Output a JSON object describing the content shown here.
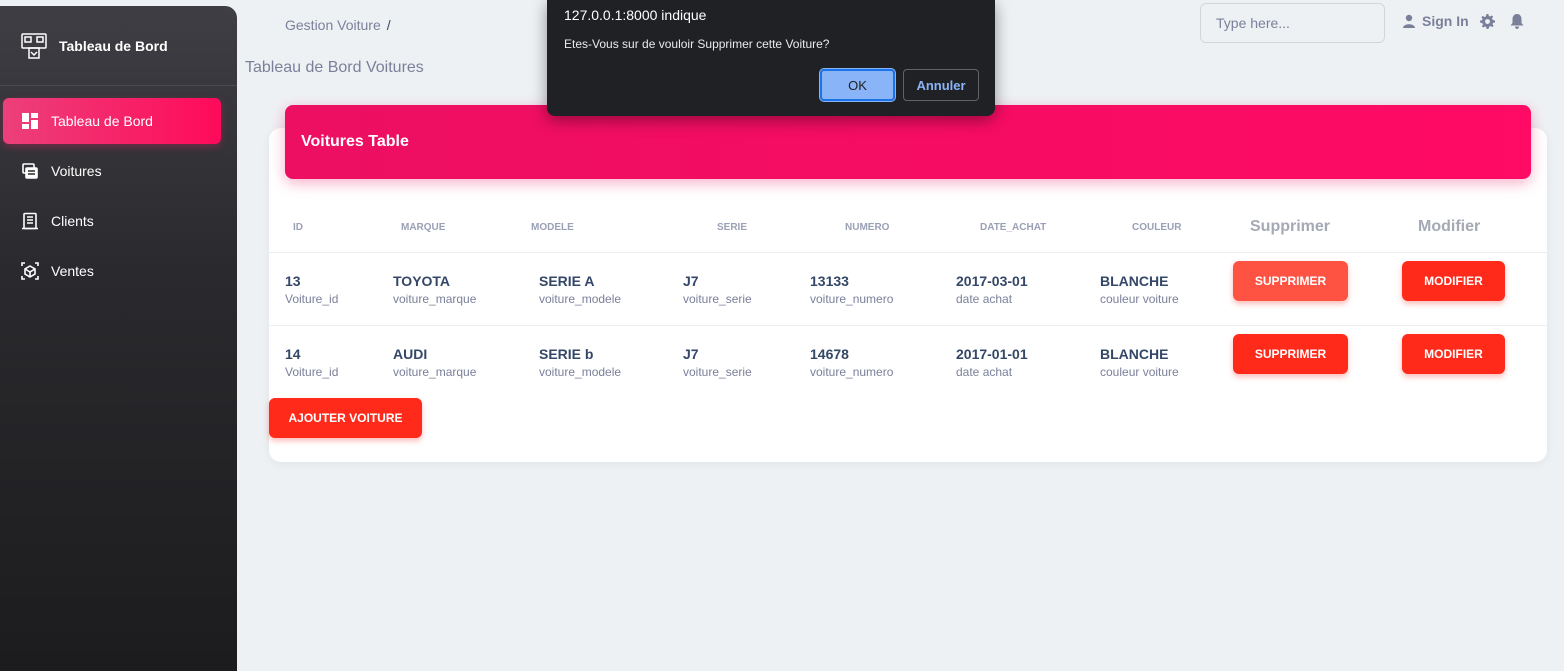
{
  "sidebar": {
    "brand": "Tableau de Bord",
    "items": [
      {
        "label": "Tableau de Bord",
        "icon": "dashboard-icon",
        "active": true
      },
      {
        "label": "Voitures",
        "icon": "car-icon"
      },
      {
        "label": "Clients",
        "icon": "clients-icon"
      },
      {
        "label": "Ventes",
        "icon": "sales-icon"
      }
    ]
  },
  "header": {
    "breadcrumb": "Gestion Voiture",
    "breadcrumb_sep": "/",
    "page_title": "Tableau de Bord Voitures",
    "search_placeholder": "Type here...",
    "signin": "Sign In"
  },
  "table": {
    "title": "Voitures Table",
    "columns": [
      "ID",
      "MARQUE",
      "MODELE",
      "SERIE",
      "NUMERO",
      "DATE_ACHAT",
      "COULEUR",
      "Supprimer",
      "Modifier"
    ],
    "rows": [
      {
        "id": "13",
        "id_sub": "Voiture_id",
        "marque": "TOYOTA",
        "marque_sub": "voiture_marque",
        "modele": "SERIE A",
        "modele_sub": "voiture_modele",
        "serie": "J7",
        "serie_sub": "voiture_serie",
        "numero": "13133",
        "numero_sub": "voiture_numero",
        "date": "2017-03-01",
        "date_sub": "date achat",
        "couleur": "BLANCHE",
        "couleur_sub": "couleur voiture",
        "delete": "SUPPRIMER",
        "edit": "MODIFIER"
      },
      {
        "id": "14",
        "id_sub": "Voiture_id",
        "marque": "AUDI",
        "marque_sub": "voiture_marque",
        "modele": "SERIE b",
        "modele_sub": "voiture_modele",
        "serie": "J7",
        "serie_sub": "voiture_serie",
        "numero": "14678",
        "numero_sub": "voiture_numero",
        "date": "2017-01-01",
        "date_sub": "date achat",
        "couleur": "BLANCHE",
        "couleur_sub": "couleur voiture",
        "delete": "SUPPRIMER",
        "edit": "MODIFIER"
      }
    ],
    "add_button": "AJOUTER VOITURE"
  },
  "dialog": {
    "title": "127.0.0.1:8000 indique",
    "message": "Etes-Vous sur de vouloir Supprimer cette Voiture?",
    "ok": "OK",
    "cancel": "Annuler"
  },
  "colors": {
    "accent": "#e91e63",
    "danger": "#ff2a1a",
    "sidebar": "#2a2a2e"
  }
}
